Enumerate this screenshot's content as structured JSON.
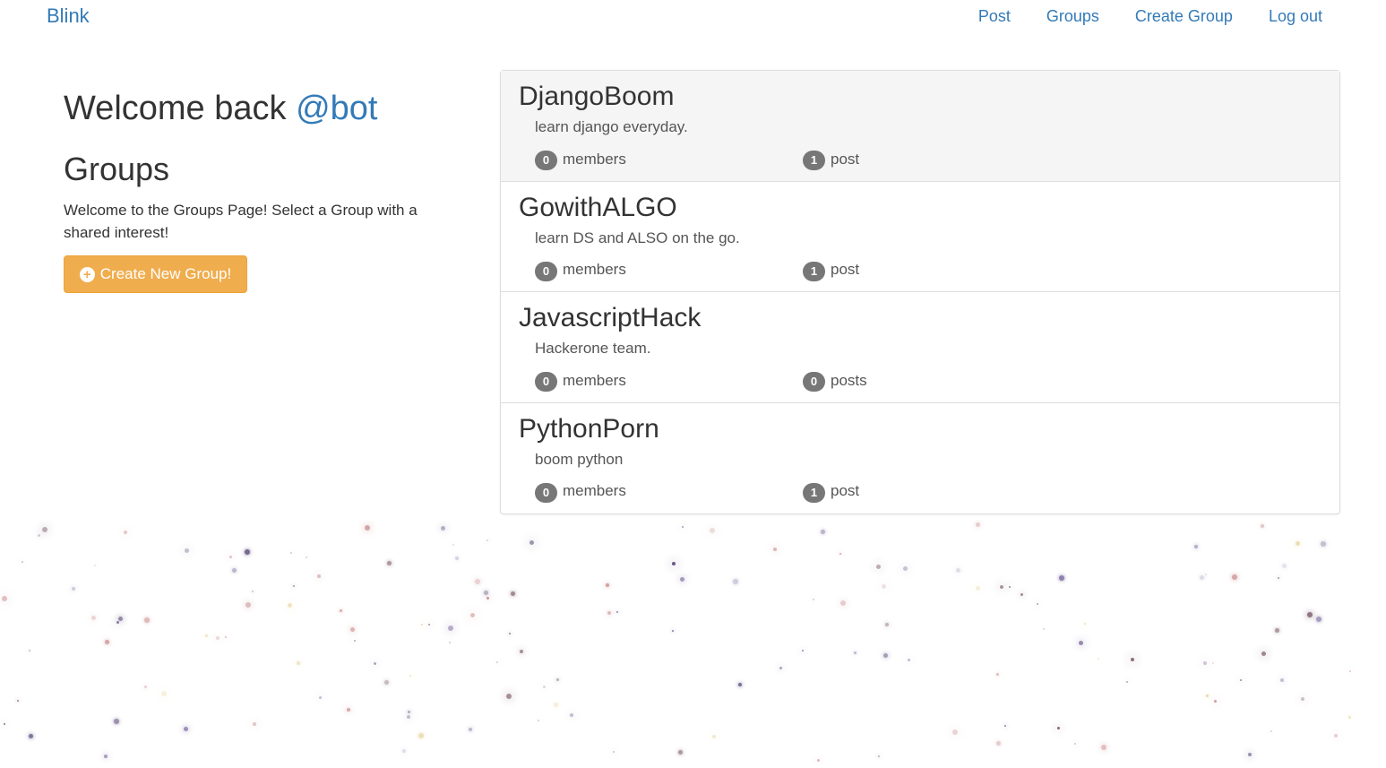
{
  "navbar": {
    "brand": "Blink",
    "links": [
      "Post",
      "Groups",
      "Create Group",
      "Log out"
    ]
  },
  "welcome": {
    "prefix": "Welcome back",
    "username": "@bot"
  },
  "groups_section": {
    "heading": "Groups",
    "intro": "Welcome to the Groups Page! Select a Group with a shared interest!",
    "create_button": "Create New Group!"
  },
  "groups": [
    {
      "name": "DjangoBoom",
      "description": "learn django everyday.",
      "members_count": "0",
      "members_label": "members",
      "posts_count": "1",
      "posts_label": "post"
    },
    {
      "name": "GowithALGO",
      "description": "learn DS and ALSO on the go.",
      "members_count": "0",
      "members_label": "members",
      "posts_count": "1",
      "posts_label": "post"
    },
    {
      "name": "JavascriptHack",
      "description": "Hackerone team.",
      "members_count": "0",
      "members_label": "members",
      "posts_count": "0",
      "posts_label": "posts"
    },
    {
      "name": "PythonPorn",
      "description": "boom python",
      "members_count": "0",
      "members_label": "members",
      "posts_count": "1",
      "posts_label": "post"
    }
  ],
  "colors": {
    "link": "#337ab7",
    "warning_button": "#f0ad4e",
    "badge": "#777777",
    "active_row": "#f5f5f5"
  }
}
